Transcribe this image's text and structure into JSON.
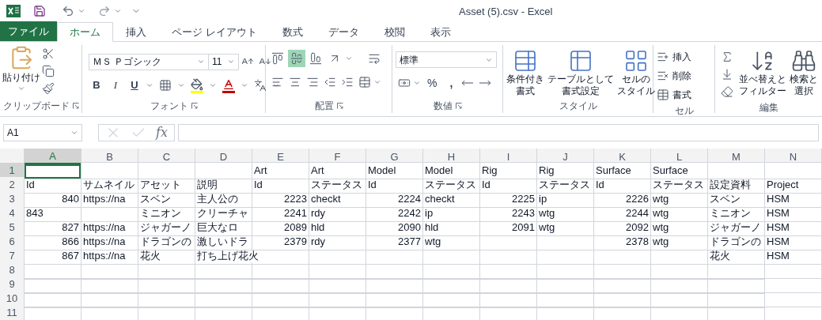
{
  "window": {
    "title": "Asset (5).csv - Excel"
  },
  "tabs": [
    {
      "label": "ファイル",
      "kind": "file",
      "selected": false
    },
    {
      "label": "ホーム",
      "kind": "tab",
      "selected": true
    },
    {
      "label": "挿入",
      "kind": "tab",
      "selected": false
    },
    {
      "label": "ページ レイアウト",
      "kind": "tab",
      "selected": false
    },
    {
      "label": "数式",
      "kind": "tab",
      "selected": false
    },
    {
      "label": "データ",
      "kind": "tab",
      "selected": false
    },
    {
      "label": "校閲",
      "kind": "tab",
      "selected": false
    },
    {
      "label": "表示",
      "kind": "tab",
      "selected": false
    }
  ],
  "ribbon": {
    "clipboard": {
      "paste_label": "貼り付け",
      "group_label": "クリップボード"
    },
    "font": {
      "font_name": "ＭＳ Ｐゴシック",
      "font_size": "11",
      "bold": "B",
      "italic": "I",
      "underline": "U",
      "group_label": "フォント"
    },
    "alignment": {
      "vertical_align_buttons": [
        {
          "selected": false
        },
        {
          "selected": true
        },
        {
          "selected": false
        }
      ],
      "group_label": "配置"
    },
    "number": {
      "format": "標準",
      "percent": "%",
      "comma": ",",
      "group_label": "数値"
    },
    "styles": {
      "buttons": [
        {
          "lines": [
            "条件付き",
            "書式"
          ]
        },
        {
          "lines": [
            "テーブルとして",
            "書式設定"
          ]
        },
        {
          "lines": [
            "セルの",
            "スタイル"
          ]
        }
      ],
      "group_label": "スタイル"
    },
    "cells": {
      "buttons": [
        "挿入",
        "削除",
        "書式"
      ],
      "group_label": "セル"
    },
    "editing": {
      "buttons": [
        {
          "lines": [
            "並べ替えと",
            "フィルター"
          ]
        },
        {
          "lines": [
            "検索と",
            "選択"
          ]
        }
      ],
      "group_label": "編集"
    }
  },
  "formula_bar": {
    "name_box": "A1",
    "function_label": "fx"
  },
  "columns": [
    {
      "label": "A",
      "selected": true
    },
    {
      "label": "B",
      "selected": false
    },
    {
      "label": "C",
      "selected": false
    },
    {
      "label": "D",
      "selected": false
    },
    {
      "label": "E",
      "selected": false
    },
    {
      "label": "F",
      "selected": false
    },
    {
      "label": "G",
      "selected": false
    },
    {
      "label": "H",
      "selected": false
    },
    {
      "label": "I",
      "selected": false
    },
    {
      "label": "J",
      "selected": false
    },
    {
      "label": "K",
      "selected": false
    },
    {
      "label": "L",
      "selected": false
    },
    {
      "label": "M",
      "selected": false
    },
    {
      "label": "N",
      "selected": false
    }
  ],
  "rows": [
    {
      "number": "1",
      "selected": true,
      "cells": [
        null,
        null,
        null,
        null,
        "Art",
        "Art",
        "Model",
        "Model",
        "Rig",
        "Rig",
        "Surface",
        "Surface",
        null,
        null
      ]
    },
    {
      "number": "2",
      "selected": false,
      "cells": [
        "Id",
        "サムネイル",
        "アセット",
        "説明",
        "Id",
        "ステータス",
        "Id",
        "ステータス",
        "Id",
        "ステータス",
        "Id",
        "ステータス",
        "設定資料",
        "Project"
      ]
    },
    {
      "number": "3",
      "selected": false,
      "cells": [
        {
          "text": "840",
          "kind": "number"
        },
        "https://na",
        "スベン",
        "主人公の",
        {
          "text": "2223",
          "kind": "number"
        },
        "checkt",
        {
          "text": "2224",
          "kind": "number"
        },
        "checkt",
        {
          "text": "2225",
          "kind": "number"
        },
        "ip",
        {
          "text": "2226",
          "kind": "number"
        },
        "wtg",
        "スベン",
        "HSM"
      ]
    },
    {
      "number": "4",
      "selected": false,
      "cells": [
        "843",
        null,
        "ミニオン",
        "クリーチャ",
        {
          "text": "2241",
          "kind": "number"
        },
        "rdy",
        {
          "text": "2242",
          "kind": "number"
        },
        "ip",
        {
          "text": "2243",
          "kind": "number"
        },
        "wtg",
        {
          "text": "2244",
          "kind": "number"
        },
        "wtg",
        "ミニオン",
        "HSM"
      ]
    },
    {
      "number": "5",
      "selected": false,
      "cells": [
        {
          "text": "827",
          "kind": "number"
        },
        "https://na",
        "ジャガーノ",
        "巨大なロ",
        {
          "text": "2089",
          "kind": "number"
        },
        "hld",
        {
          "text": "2090",
          "kind": "number"
        },
        "hld",
        {
          "text": "2091",
          "kind": "number"
        },
        "wtg",
        {
          "text": "2092",
          "kind": "number"
        },
        "wtg",
        "ジャガーノ",
        "HSM"
      ]
    },
    {
      "number": "6",
      "selected": false,
      "cells": [
        {
          "text": "866",
          "kind": "number"
        },
        "https://na",
        "ドラゴンの",
        "激しいドラ",
        {
          "text": "2379",
          "kind": "number"
        },
        "rdy",
        {
          "text": "2377",
          "kind": "number"
        },
        "wtg",
        null,
        null,
        {
          "text": "2378",
          "kind": "number"
        },
        "wtg",
        "ドラゴンの",
        "HSM"
      ]
    },
    {
      "number": "7",
      "selected": false,
      "cells": [
        {
          "text": "867",
          "kind": "number"
        },
        "https://na",
        "花火",
        {
          "text": "打ち上げ花火",
          "kind": "overflow"
        },
        null,
        null,
        null,
        null,
        null,
        null,
        null,
        null,
        "花火",
        "HSM"
      ]
    },
    {
      "number": "8",
      "selected": false
    },
    {
      "number": "9",
      "selected": false
    },
    {
      "number": "10",
      "selected": false
    },
    {
      "number": "11",
      "selected": false
    }
  ]
}
